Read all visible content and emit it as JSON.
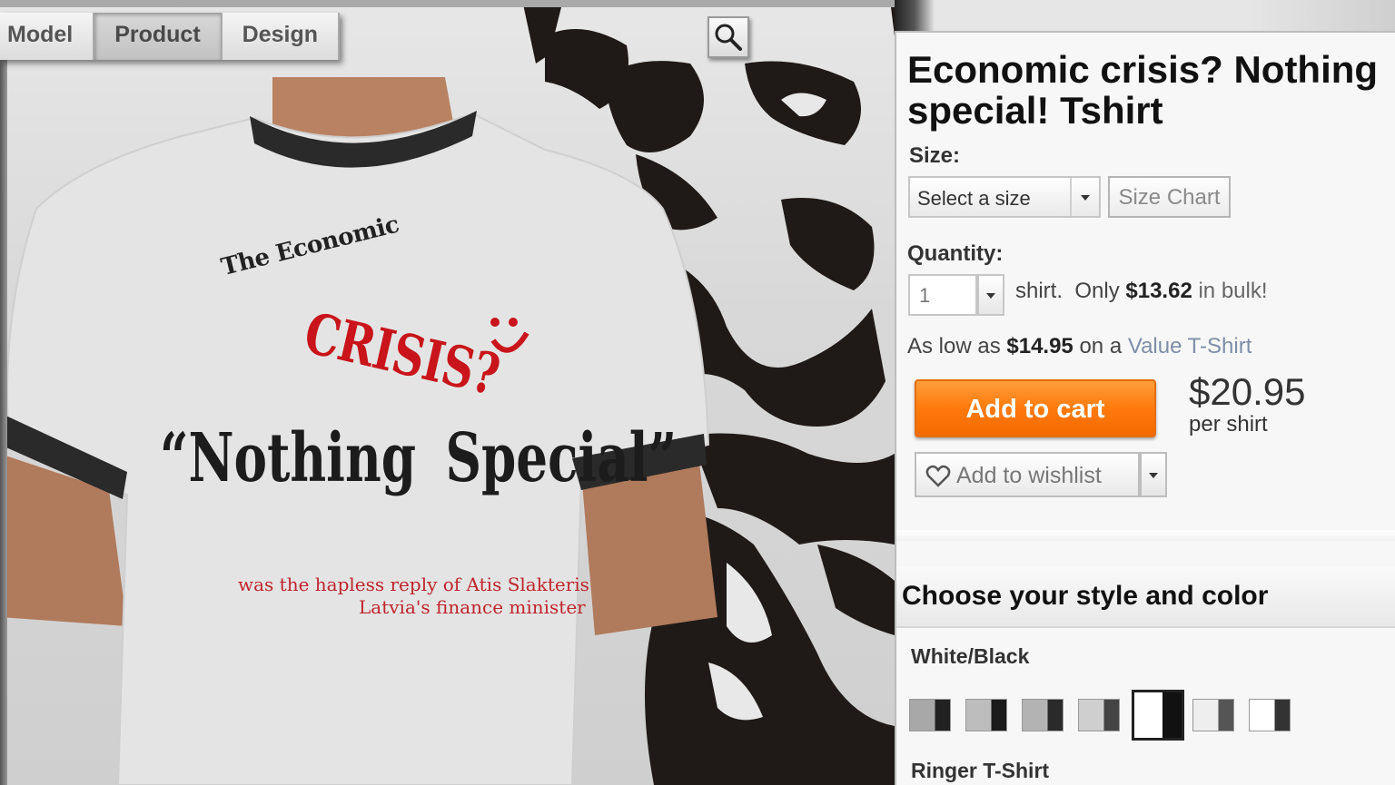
{
  "viewer": {
    "tabs": [
      {
        "label": "Model",
        "active": false
      },
      {
        "label": "Product",
        "active": true
      },
      {
        "label": "Design",
        "active": false
      }
    ],
    "zoom_icon": "magnifier-icon",
    "shirt_print": {
      "line1": "The Economic",
      "line2": "CRISIS?",
      "line3": "“Nothing  Special”",
      "line4": "was the hapless reply of Atis Slakteris",
      "line5": "Latvia's finance minister"
    }
  },
  "product": {
    "title": "Economic crisis? Nothing special! Tshirt",
    "size_label": "Size:",
    "size_select": "Select a size",
    "size_chart": "Size Chart",
    "quantity_label": "Quantity:",
    "quantity_value": "1",
    "qty_unit": "shirt.",
    "qty_only": "Only",
    "bulk_price": "$13.62",
    "qty_bulk": "in bulk!",
    "lowas_prefix": "As low as",
    "lowas_price": "$14.95",
    "lowas_on": "on a",
    "lowas_link": "Value T-Shirt",
    "add_to_cart": "Add to cart",
    "price": "$20.95",
    "per": "per shirt",
    "wishlist": "Add to wishlist"
  },
  "style": {
    "header": "Choose your style and color",
    "color_name": "White/Black",
    "style_name": "Ringer T-Shirt",
    "swatches": [
      {
        "a": "#a8a8a8",
        "b": "#222222"
      },
      {
        "a": "#bdbdbd",
        "b": "#1a1a1a"
      },
      {
        "a": "#b3b3b3",
        "b": "#2a2a2a"
      },
      {
        "a": "#cfcfcf",
        "b": "#444444"
      },
      {
        "a": "#ffffff",
        "b": "#111111",
        "selected": true
      },
      {
        "a": "#eeeeee",
        "b": "#555555"
      },
      {
        "a": "#ffffff",
        "b": "#333333"
      }
    ]
  },
  "colors": {
    "accent_orange": "#ff7a0d",
    "crisis_red": "#c8141a",
    "link_blue": "#7e8ea8"
  }
}
